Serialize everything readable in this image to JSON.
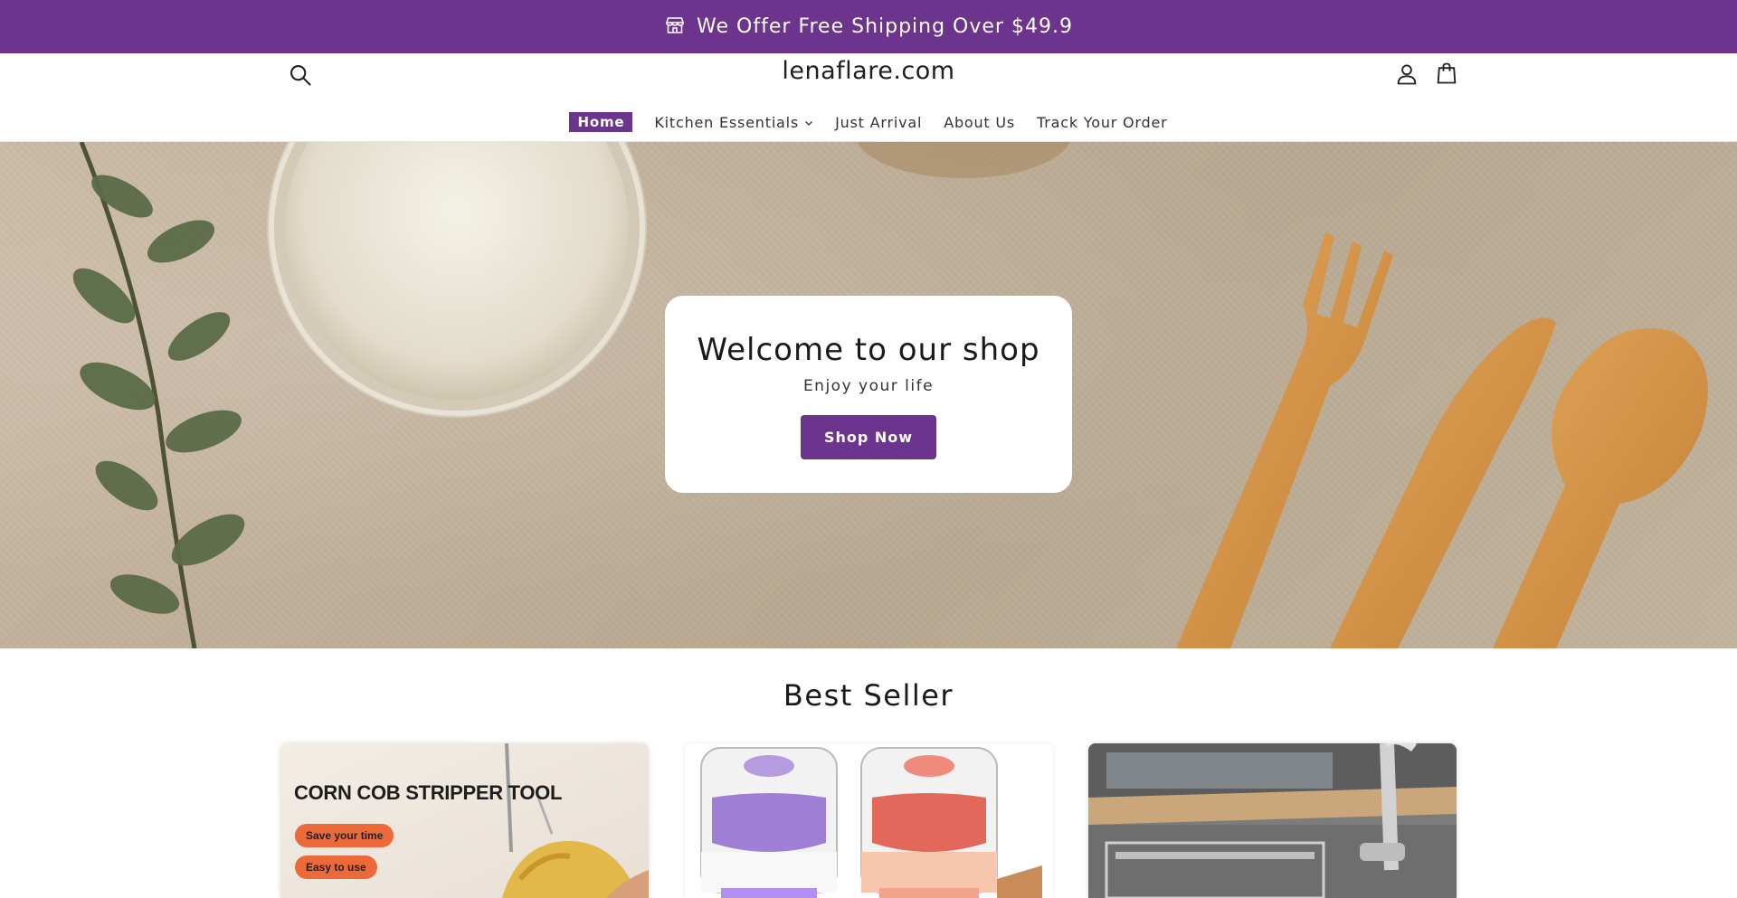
{
  "announcement": {
    "icon": "storefront-icon",
    "text": "We Offer Free Shipping Over $49.9",
    "background": "#6c348c"
  },
  "header": {
    "logo": "lenaflare.com",
    "icons": [
      "search-icon",
      "account-icon",
      "cart-icon"
    ]
  },
  "nav": {
    "items": [
      {
        "label": "Home",
        "active": true
      },
      {
        "label": "Kitchen Essentials",
        "has_dropdown": true
      },
      {
        "label": "Just Arrival"
      },
      {
        "label": "About Us"
      },
      {
        "label": "Track Your Order"
      }
    ]
  },
  "hero": {
    "title": "Welcome to our shop",
    "subtitle": "Enjoy your life",
    "button_label": "Shop Now"
  },
  "best_seller": {
    "title": "Best Seller",
    "products": [
      {
        "image_headline": "CORN COB STRIPPER TOOL",
        "image_badges": [
          "Save your time",
          "Easy to use"
        ]
      },
      {},
      {}
    ]
  },
  "colors": {
    "accent": "#6c348c",
    "badge_orange": "#ec6a3a"
  }
}
